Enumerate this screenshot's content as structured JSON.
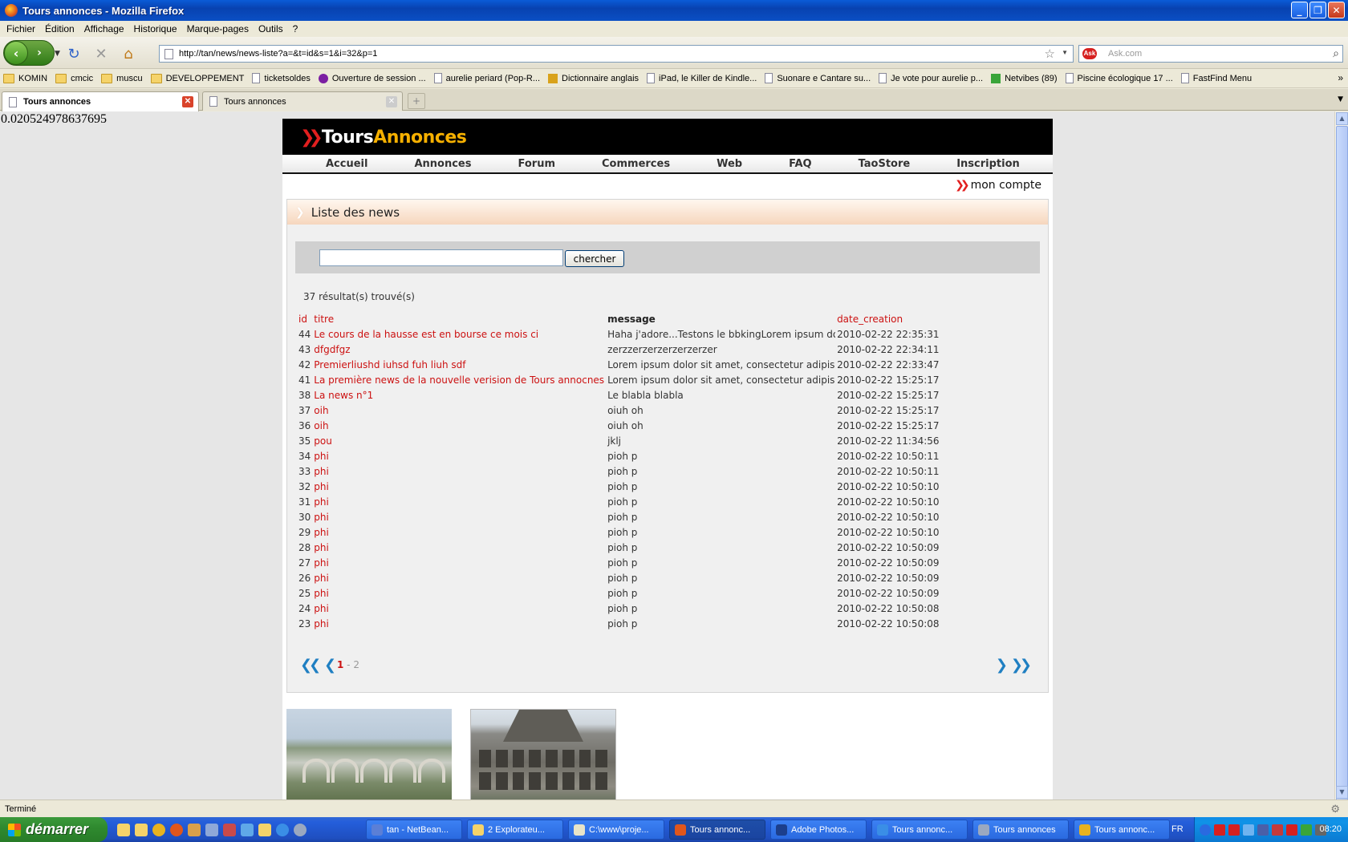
{
  "window": {
    "title": "Tours annonces - Mozilla Firefox"
  },
  "menu": [
    "Fichier",
    "Édition",
    "Affichage",
    "Historique",
    "Marque-pages",
    "Outils",
    "?"
  ],
  "toolbar": {
    "url": "http://tan/news/news-liste?a=&t=id&s=1&i=32&p=1",
    "search_placeholder": "Ask.com"
  },
  "bookmarks": [
    {
      "label": "KOMIN",
      "icon": "folder"
    },
    {
      "label": "cmcic",
      "icon": "folder"
    },
    {
      "label": "muscu",
      "icon": "folder"
    },
    {
      "label": "DEVELOPPEMENT",
      "icon": "folder"
    },
    {
      "label": "ticketsoldes",
      "icon": "page"
    },
    {
      "label": "Ouverture de session ...",
      "icon": "yahoo"
    },
    {
      "label": "aurelie periard (Pop-R...",
      "icon": "page"
    },
    {
      "label": "Dictionnaire anglais",
      "icon": "wr"
    },
    {
      "label": "iPad, le Killer de Kindle...",
      "icon": "page"
    },
    {
      "label": "Suonare e Cantare su...",
      "icon": "page"
    },
    {
      "label": "Je vote pour aurelie p...",
      "icon": "page"
    },
    {
      "label": "Netvibes (89)",
      "icon": "plus"
    },
    {
      "label": "Piscine écologique 17 ...",
      "icon": "page"
    },
    {
      "label": "FastFind Menu",
      "icon": "page"
    }
  ],
  "tabs": [
    {
      "label": "Tours annonces",
      "active": true
    },
    {
      "label": "Tours annonces",
      "active": false
    }
  ],
  "debug_text": "0.020524978637695",
  "site": {
    "logo_a": "Tours",
    "logo_b": "Annonces",
    "nav": [
      "Accueil",
      "Annonces",
      "Forum",
      "Commerces",
      "Web",
      "FAQ",
      "TaoStore",
      "Inscription"
    ],
    "account": "mon compte",
    "panel_title": "Liste des news",
    "search_button": "chercher",
    "result_count": "37 résultat(s) trouvé(s)",
    "columns": {
      "id": "id",
      "titre": "titre",
      "message": "message",
      "date": "date_creation"
    },
    "rows": [
      {
        "id": "44",
        "titre": "Le cours de la hausse est en bourse ce mois ci",
        "message": "Haha j'adore...Testons le bbkingLorem ipsum dolor",
        "date": "2010-02-22 22:35:31"
      },
      {
        "id": "43",
        "titre": "dfgdfgz",
        "message": "zerzzerzerzerzerzerzer",
        "date": "2010-02-22 22:34:11"
      },
      {
        "id": "42",
        "titre": "Premierliushd iuhsd fuh liuh sdf",
        "message": "Lorem ipsum dolor sit amet, consectetur adipiscing",
        "date": "2010-02-22 22:33:47"
      },
      {
        "id": "41",
        "titre": "La première news de la nouvelle verision de Tours annocnes",
        "message": "Lorem ipsum dolor sit amet, consectetur adipiscing",
        "date": "2010-02-22 15:25:17"
      },
      {
        "id": "38",
        "titre": "La news n°1",
        "message": "Le blabla blabla",
        "date": "2010-02-22 15:25:17"
      },
      {
        "id": "37",
        "titre": "oih",
        "message": "oiuh oh",
        "date": "2010-02-22 15:25:17"
      },
      {
        "id": "36",
        "titre": "oih",
        "message": "oiuh oh",
        "date": "2010-02-22 15:25:17"
      },
      {
        "id": "35",
        "titre": "pou",
        "message": "jklj",
        "date": "2010-02-22 11:34:56"
      },
      {
        "id": "34",
        "titre": "phi",
        "message": "pioh p",
        "date": "2010-02-22 10:50:11"
      },
      {
        "id": "33",
        "titre": "phi",
        "message": "pioh p",
        "date": "2010-02-22 10:50:11"
      },
      {
        "id": "32",
        "titre": "phi",
        "message": "pioh p",
        "date": "2010-02-22 10:50:10"
      },
      {
        "id": "31",
        "titre": "phi",
        "message": "pioh p",
        "date": "2010-02-22 10:50:10"
      },
      {
        "id": "30",
        "titre": "phi",
        "message": "pioh p",
        "date": "2010-02-22 10:50:10"
      },
      {
        "id": "29",
        "titre": "phi",
        "message": "pioh p",
        "date": "2010-02-22 10:50:10"
      },
      {
        "id": "28",
        "titre": "phi",
        "message": "pioh p",
        "date": "2010-02-22 10:50:09"
      },
      {
        "id": "27",
        "titre": "phi",
        "message": "pioh p",
        "date": "2010-02-22 10:50:09"
      },
      {
        "id": "26",
        "titre": "phi",
        "message": "pioh p",
        "date": "2010-02-22 10:50:09"
      },
      {
        "id": "25",
        "titre": "phi",
        "message": "pioh p",
        "date": "2010-02-22 10:50:09"
      },
      {
        "id": "24",
        "titre": "phi",
        "message": "pioh p",
        "date": "2010-02-22 10:50:08"
      },
      {
        "id": "23",
        "titre": "phi",
        "message": "pioh p",
        "date": "2010-02-22 10:50:08"
      }
    ],
    "pagination": {
      "current": "1",
      "sep": " - ",
      "other": "2"
    }
  },
  "status": "Terminé",
  "taskbar": {
    "start": "démarrer",
    "tasks": [
      {
        "label": "tan - NetBean...",
        "color": "#5b7fd6"
      },
      {
        "label": "2 Explorateu...",
        "color": "#f5d36a"
      },
      {
        "label": "C:\\www\\proje...",
        "color": "#e8e4c8"
      },
      {
        "label": "Tours annonc...",
        "color": "#e0561b",
        "active": true
      },
      {
        "label": "Adobe Photos...",
        "color": "#1c3f8c"
      },
      {
        "label": "Tours annonc...",
        "color": "#3a8ee6"
      },
      {
        "label": "Tours annonces",
        "color": "#9aa8c0"
      },
      {
        "label": "Tours annonc...",
        "color": "#e8b21f"
      }
    ],
    "lang": "FR",
    "clock": "08:20"
  },
  "colors": {
    "accent_red": "#cc1111",
    "link_blue": "#1f7fc2",
    "logo_orange": "#f6b000"
  }
}
